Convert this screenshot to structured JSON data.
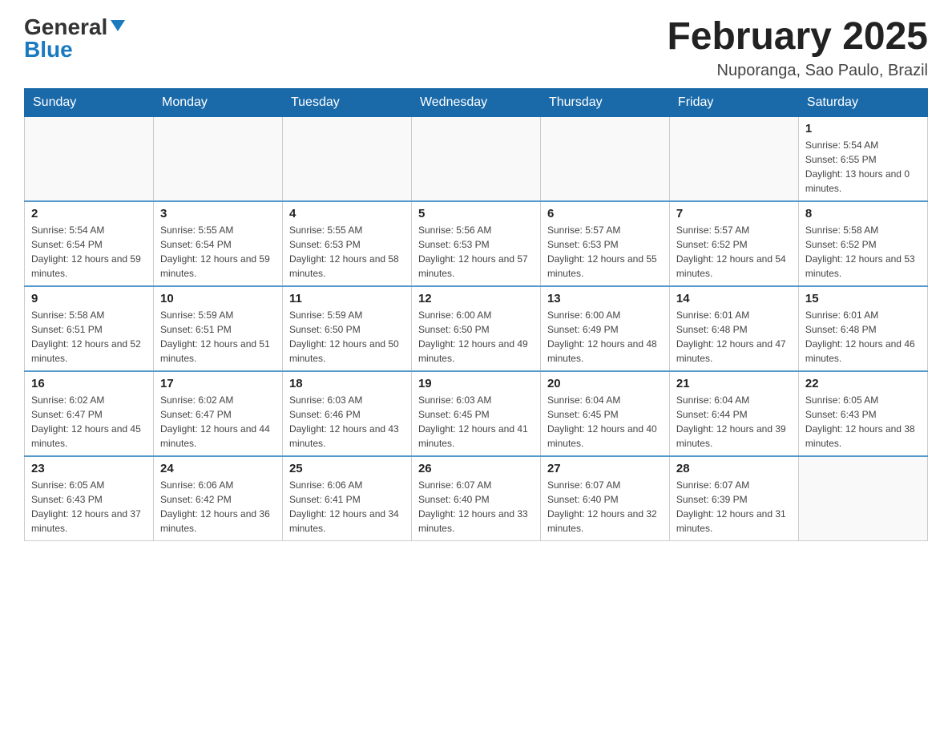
{
  "header": {
    "logo_general": "General",
    "logo_blue": "Blue",
    "title": "February 2025",
    "subtitle": "Nuporanga, Sao Paulo, Brazil"
  },
  "days_of_week": [
    "Sunday",
    "Monday",
    "Tuesday",
    "Wednesday",
    "Thursday",
    "Friday",
    "Saturday"
  ],
  "weeks": [
    [
      {
        "day": "",
        "info": ""
      },
      {
        "day": "",
        "info": ""
      },
      {
        "day": "",
        "info": ""
      },
      {
        "day": "",
        "info": ""
      },
      {
        "day": "",
        "info": ""
      },
      {
        "day": "",
        "info": ""
      },
      {
        "day": "1",
        "info": "Sunrise: 5:54 AM\nSunset: 6:55 PM\nDaylight: 13 hours and 0 minutes."
      }
    ],
    [
      {
        "day": "2",
        "info": "Sunrise: 5:54 AM\nSunset: 6:54 PM\nDaylight: 12 hours and 59 minutes."
      },
      {
        "day": "3",
        "info": "Sunrise: 5:55 AM\nSunset: 6:54 PM\nDaylight: 12 hours and 59 minutes."
      },
      {
        "day": "4",
        "info": "Sunrise: 5:55 AM\nSunset: 6:53 PM\nDaylight: 12 hours and 58 minutes."
      },
      {
        "day": "5",
        "info": "Sunrise: 5:56 AM\nSunset: 6:53 PM\nDaylight: 12 hours and 57 minutes."
      },
      {
        "day": "6",
        "info": "Sunrise: 5:57 AM\nSunset: 6:53 PM\nDaylight: 12 hours and 55 minutes."
      },
      {
        "day": "7",
        "info": "Sunrise: 5:57 AM\nSunset: 6:52 PM\nDaylight: 12 hours and 54 minutes."
      },
      {
        "day": "8",
        "info": "Sunrise: 5:58 AM\nSunset: 6:52 PM\nDaylight: 12 hours and 53 minutes."
      }
    ],
    [
      {
        "day": "9",
        "info": "Sunrise: 5:58 AM\nSunset: 6:51 PM\nDaylight: 12 hours and 52 minutes."
      },
      {
        "day": "10",
        "info": "Sunrise: 5:59 AM\nSunset: 6:51 PM\nDaylight: 12 hours and 51 minutes."
      },
      {
        "day": "11",
        "info": "Sunrise: 5:59 AM\nSunset: 6:50 PM\nDaylight: 12 hours and 50 minutes."
      },
      {
        "day": "12",
        "info": "Sunrise: 6:00 AM\nSunset: 6:50 PM\nDaylight: 12 hours and 49 minutes."
      },
      {
        "day": "13",
        "info": "Sunrise: 6:00 AM\nSunset: 6:49 PM\nDaylight: 12 hours and 48 minutes."
      },
      {
        "day": "14",
        "info": "Sunrise: 6:01 AM\nSunset: 6:48 PM\nDaylight: 12 hours and 47 minutes."
      },
      {
        "day": "15",
        "info": "Sunrise: 6:01 AM\nSunset: 6:48 PM\nDaylight: 12 hours and 46 minutes."
      }
    ],
    [
      {
        "day": "16",
        "info": "Sunrise: 6:02 AM\nSunset: 6:47 PM\nDaylight: 12 hours and 45 minutes."
      },
      {
        "day": "17",
        "info": "Sunrise: 6:02 AM\nSunset: 6:47 PM\nDaylight: 12 hours and 44 minutes."
      },
      {
        "day": "18",
        "info": "Sunrise: 6:03 AM\nSunset: 6:46 PM\nDaylight: 12 hours and 43 minutes."
      },
      {
        "day": "19",
        "info": "Sunrise: 6:03 AM\nSunset: 6:45 PM\nDaylight: 12 hours and 41 minutes."
      },
      {
        "day": "20",
        "info": "Sunrise: 6:04 AM\nSunset: 6:45 PM\nDaylight: 12 hours and 40 minutes."
      },
      {
        "day": "21",
        "info": "Sunrise: 6:04 AM\nSunset: 6:44 PM\nDaylight: 12 hours and 39 minutes."
      },
      {
        "day": "22",
        "info": "Sunrise: 6:05 AM\nSunset: 6:43 PM\nDaylight: 12 hours and 38 minutes."
      }
    ],
    [
      {
        "day": "23",
        "info": "Sunrise: 6:05 AM\nSunset: 6:43 PM\nDaylight: 12 hours and 37 minutes."
      },
      {
        "day": "24",
        "info": "Sunrise: 6:06 AM\nSunset: 6:42 PM\nDaylight: 12 hours and 36 minutes."
      },
      {
        "day": "25",
        "info": "Sunrise: 6:06 AM\nSunset: 6:41 PM\nDaylight: 12 hours and 34 minutes."
      },
      {
        "day": "26",
        "info": "Sunrise: 6:07 AM\nSunset: 6:40 PM\nDaylight: 12 hours and 33 minutes."
      },
      {
        "day": "27",
        "info": "Sunrise: 6:07 AM\nSunset: 6:40 PM\nDaylight: 12 hours and 32 minutes."
      },
      {
        "day": "28",
        "info": "Sunrise: 6:07 AM\nSunset: 6:39 PM\nDaylight: 12 hours and 31 minutes."
      },
      {
        "day": "",
        "info": ""
      }
    ]
  ]
}
